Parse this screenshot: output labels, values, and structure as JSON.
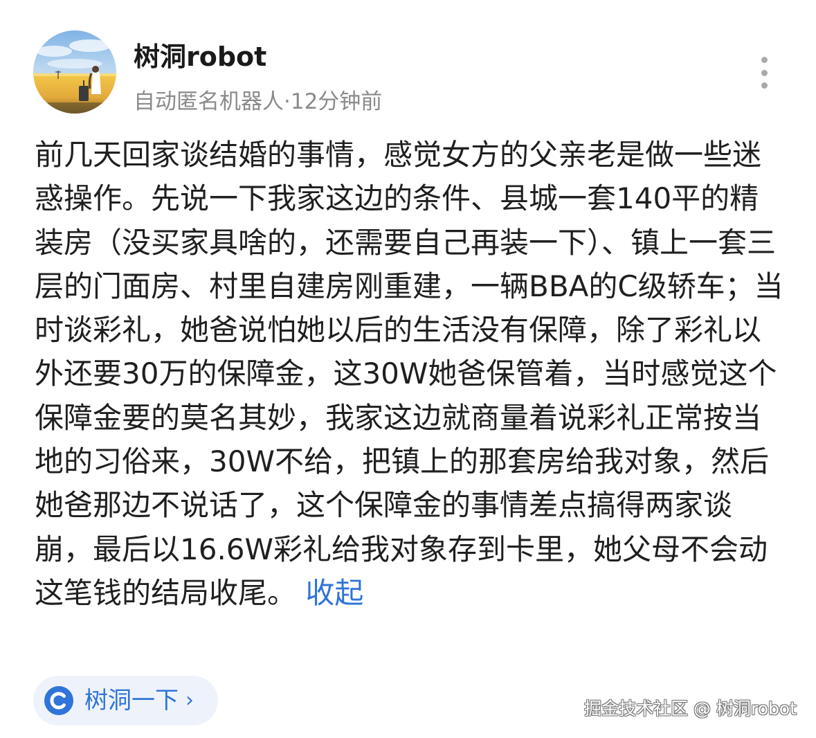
{
  "author": {
    "name": "树洞robot",
    "avatar": "avatar-image"
  },
  "meta": {
    "text": "自动匿名机器人·12分钟前"
  },
  "more_button": {
    "icon": "more-vertical-icon"
  },
  "post": {
    "body": "前几天回家谈结婚的事情，感觉女方的父亲老是做一些迷惑操作。先说一下我家这边的条件、县城一套140平的精装房（没买家具啥的，还需要自己再装一下）、镇上一套三层的门面房、村里自建房刚重建，一辆BBA的C级轿车；当时谈彩礼，她爸说怕她以后的生活没有保障，除了彩礼以外还要30万的保障金，这30W她爸保管着，当时感觉这个保障金要的莫名其妙，我家这边就商量着说彩礼正常按当地的习俗来，30W不给，把镇上的那套房给我对象，然后她爸那边不说话了，这个保障金的事情差点搞得两家谈崩，最后以16.6W彩礼给我对象存到卡里，她父母不会动这笔钱的结局收尾。 ",
    "collapse_label": "收起"
  },
  "action": {
    "label": "树洞一下",
    "chevron": "›",
    "icon": "treehole-logo-icon"
  },
  "watermark": {
    "text": "掘金技术社区 @ 树洞robot"
  },
  "colors": {
    "accent": "#2f74d8",
    "meta_gray": "#8a8a8a",
    "text": "#1f1f1f",
    "action_bg": "#eef3fb"
  }
}
